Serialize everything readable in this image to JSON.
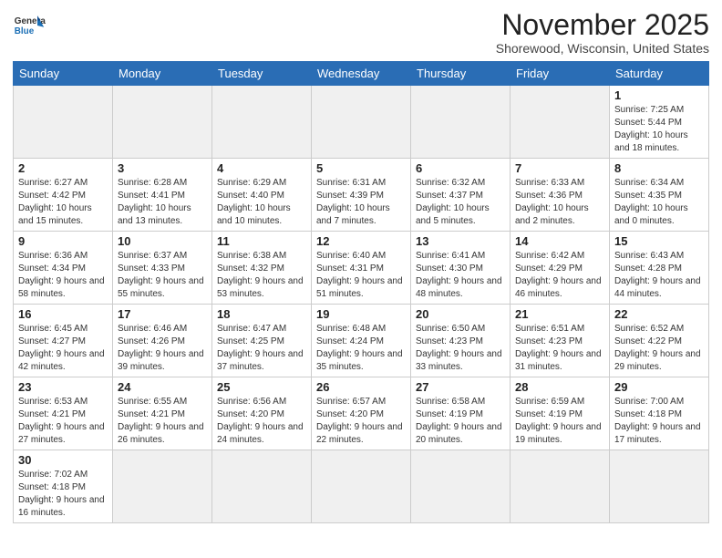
{
  "header": {
    "logo_general": "General",
    "logo_blue": "Blue",
    "month_title": "November 2025",
    "location": "Shorewood, Wisconsin, United States"
  },
  "weekdays": [
    "Sunday",
    "Monday",
    "Tuesday",
    "Wednesday",
    "Thursday",
    "Friday",
    "Saturday"
  ],
  "weeks": [
    [
      {
        "day": "",
        "info": ""
      },
      {
        "day": "",
        "info": ""
      },
      {
        "day": "",
        "info": ""
      },
      {
        "day": "",
        "info": ""
      },
      {
        "day": "",
        "info": ""
      },
      {
        "day": "",
        "info": ""
      },
      {
        "day": "1",
        "info": "Sunrise: 7:25 AM\nSunset: 5:44 PM\nDaylight: 10 hours\nand 18 minutes."
      }
    ],
    [
      {
        "day": "2",
        "info": "Sunrise: 6:27 AM\nSunset: 4:42 PM\nDaylight: 10 hours\nand 15 minutes."
      },
      {
        "day": "3",
        "info": "Sunrise: 6:28 AM\nSunset: 4:41 PM\nDaylight: 10 hours\nand 13 minutes."
      },
      {
        "day": "4",
        "info": "Sunrise: 6:29 AM\nSunset: 4:40 PM\nDaylight: 10 hours\nand 10 minutes."
      },
      {
        "day": "5",
        "info": "Sunrise: 6:31 AM\nSunset: 4:39 PM\nDaylight: 10 hours\nand 7 minutes."
      },
      {
        "day": "6",
        "info": "Sunrise: 6:32 AM\nSunset: 4:37 PM\nDaylight: 10 hours\nand 5 minutes."
      },
      {
        "day": "7",
        "info": "Sunrise: 6:33 AM\nSunset: 4:36 PM\nDaylight: 10 hours\nand 2 minutes."
      },
      {
        "day": "8",
        "info": "Sunrise: 6:34 AM\nSunset: 4:35 PM\nDaylight: 10 hours\nand 0 minutes."
      }
    ],
    [
      {
        "day": "9",
        "info": "Sunrise: 6:36 AM\nSunset: 4:34 PM\nDaylight: 9 hours\nand 58 minutes."
      },
      {
        "day": "10",
        "info": "Sunrise: 6:37 AM\nSunset: 4:33 PM\nDaylight: 9 hours\nand 55 minutes."
      },
      {
        "day": "11",
        "info": "Sunrise: 6:38 AM\nSunset: 4:32 PM\nDaylight: 9 hours\nand 53 minutes."
      },
      {
        "day": "12",
        "info": "Sunrise: 6:40 AM\nSunset: 4:31 PM\nDaylight: 9 hours\nand 51 minutes."
      },
      {
        "day": "13",
        "info": "Sunrise: 6:41 AM\nSunset: 4:30 PM\nDaylight: 9 hours\nand 48 minutes."
      },
      {
        "day": "14",
        "info": "Sunrise: 6:42 AM\nSunset: 4:29 PM\nDaylight: 9 hours\nand 46 minutes."
      },
      {
        "day": "15",
        "info": "Sunrise: 6:43 AM\nSunset: 4:28 PM\nDaylight: 9 hours\nand 44 minutes."
      }
    ],
    [
      {
        "day": "16",
        "info": "Sunrise: 6:45 AM\nSunset: 4:27 PM\nDaylight: 9 hours\nand 42 minutes."
      },
      {
        "day": "17",
        "info": "Sunrise: 6:46 AM\nSunset: 4:26 PM\nDaylight: 9 hours\nand 39 minutes."
      },
      {
        "day": "18",
        "info": "Sunrise: 6:47 AM\nSunset: 4:25 PM\nDaylight: 9 hours\nand 37 minutes."
      },
      {
        "day": "19",
        "info": "Sunrise: 6:48 AM\nSunset: 4:24 PM\nDaylight: 9 hours\nand 35 minutes."
      },
      {
        "day": "20",
        "info": "Sunrise: 6:50 AM\nSunset: 4:23 PM\nDaylight: 9 hours\nand 33 minutes."
      },
      {
        "day": "21",
        "info": "Sunrise: 6:51 AM\nSunset: 4:23 PM\nDaylight: 9 hours\nand 31 minutes."
      },
      {
        "day": "22",
        "info": "Sunrise: 6:52 AM\nSunset: 4:22 PM\nDaylight: 9 hours\nand 29 minutes."
      }
    ],
    [
      {
        "day": "23",
        "info": "Sunrise: 6:53 AM\nSunset: 4:21 PM\nDaylight: 9 hours\nand 27 minutes."
      },
      {
        "day": "24",
        "info": "Sunrise: 6:55 AM\nSunset: 4:21 PM\nDaylight: 9 hours\nand 26 minutes."
      },
      {
        "day": "25",
        "info": "Sunrise: 6:56 AM\nSunset: 4:20 PM\nDaylight: 9 hours\nand 24 minutes."
      },
      {
        "day": "26",
        "info": "Sunrise: 6:57 AM\nSunset: 4:20 PM\nDaylight: 9 hours\nand 22 minutes."
      },
      {
        "day": "27",
        "info": "Sunrise: 6:58 AM\nSunset: 4:19 PM\nDaylight: 9 hours\nand 20 minutes."
      },
      {
        "day": "28",
        "info": "Sunrise: 6:59 AM\nSunset: 4:19 PM\nDaylight: 9 hours\nand 19 minutes."
      },
      {
        "day": "29",
        "info": "Sunrise: 7:00 AM\nSunset: 4:18 PM\nDaylight: 9 hours\nand 17 minutes."
      }
    ],
    [
      {
        "day": "30",
        "info": "Sunrise: 7:02 AM\nSunset: 4:18 PM\nDaylight: 9 hours\nand 16 minutes."
      },
      {
        "day": "",
        "info": ""
      },
      {
        "day": "",
        "info": ""
      },
      {
        "day": "",
        "info": ""
      },
      {
        "day": "",
        "info": ""
      },
      {
        "day": "",
        "info": ""
      },
      {
        "day": "",
        "info": ""
      }
    ]
  ]
}
